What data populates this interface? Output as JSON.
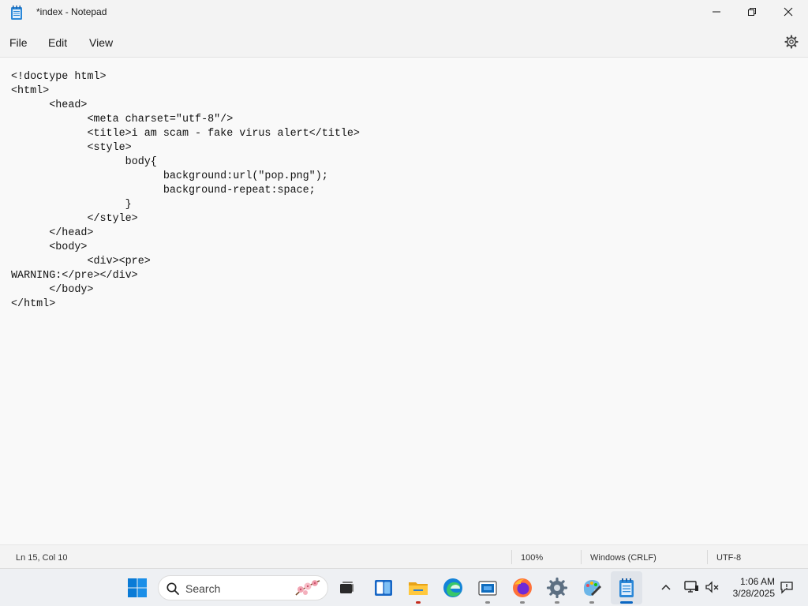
{
  "window": {
    "title": "*index - Notepad"
  },
  "menu": {
    "file": "File",
    "edit": "Edit",
    "view": "View"
  },
  "editor": {
    "content": "<!doctype html>\n<html>\n\t<head>\n\t\t<meta charset=\"utf-8\"/>\n\t\t<title>i am scam - fake virus alert</title>\n\t\t<style>\n\t\t\tbody{\n\t\t\t\tbackground:url(\"pop.png\");\n\t\t\t\tbackground-repeat:space;\n\t\t\t}\n\t\t</style>\n\t</head>\n\t<body>\n\t\t<div><pre>\nWARNING:</pre></div>\n\t</body>\n</html>"
  },
  "status": {
    "position": "Ln 15, Col 10",
    "zoom": "100%",
    "line_ending": "Windows (CRLF)",
    "encoding": "UTF-8"
  },
  "taskbar": {
    "search_label": "Search",
    "time": "1:06 AM",
    "date": "3/28/2025"
  },
  "icons": {
    "app": "notepad-icon",
    "settings": "gear-icon",
    "start": "windows-start-icon",
    "search": "search-icon",
    "task_view": "task-view-icon",
    "widgets": "widgets-icon",
    "explorer": "file-explorer-icon",
    "edge": "edge-icon",
    "store": "store-icon",
    "firefox": "firefox-icon",
    "settings_app": "settings-app-icon",
    "paint": "paint-icon",
    "notepad": "notepad-taskbar-icon"
  }
}
